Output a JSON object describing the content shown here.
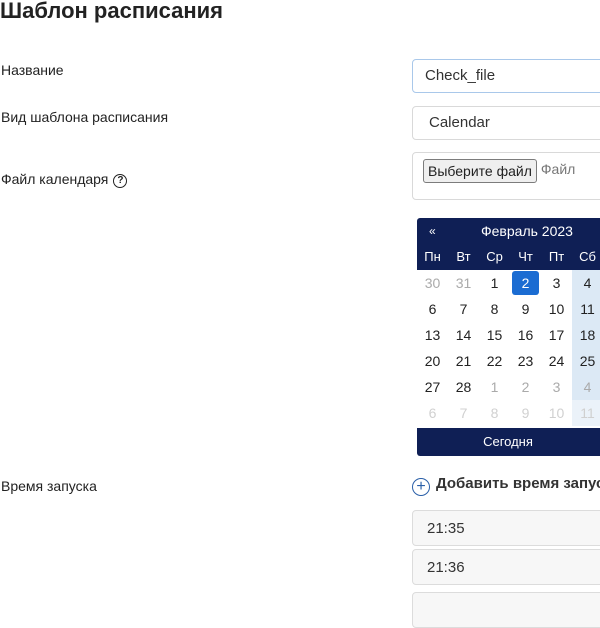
{
  "page": {
    "title": "Шаблон расписания"
  },
  "form": {
    "name_label": "Название",
    "name_value": "Check_file",
    "type_label": "Вид шаблона расписания",
    "type_value": "Calendar",
    "file_label": "Файл календаря",
    "help_icon": "question-circle-icon",
    "file_button": "Выберите файл",
    "file_hint": "Файл",
    "run_time_label": "Время запуска",
    "add_time_label": "Добавить время запуска",
    "add_time_icon": "plus-circle-icon",
    "times": [
      "21:35",
      "21:36"
    ]
  },
  "calendar": {
    "prev": "«",
    "month": "Февраль 2023",
    "weekdays": [
      "Пн",
      "Вт",
      "Ср",
      "Чт",
      "Пт",
      "Сб"
    ],
    "weeks": [
      [
        "30",
        "31",
        "1",
        "2",
        "3",
        "4"
      ],
      [
        "6",
        "7",
        "8",
        "9",
        "10",
        "11"
      ],
      [
        "13",
        "14",
        "15",
        "16",
        "17",
        "18"
      ],
      [
        "20",
        "21",
        "22",
        "23",
        "24",
        "25"
      ],
      [
        "27",
        "28",
        "1",
        "2",
        "3",
        "4"
      ],
      [
        "6",
        "7",
        "8",
        "9",
        "10",
        "11"
      ]
    ],
    "selected": "2",
    "today_button": "Сегодня",
    "accent_color": "#0f1f55",
    "selected_color": "#1b6cd2"
  }
}
